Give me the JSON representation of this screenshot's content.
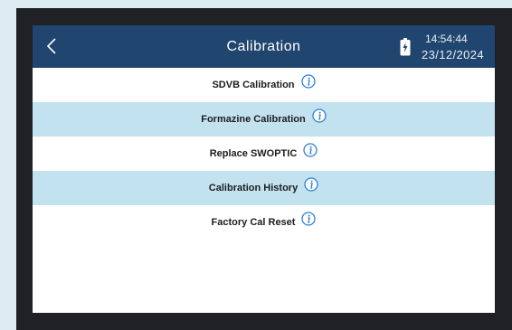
{
  "header": {
    "title": "Calibration",
    "time": "14:54:44",
    "date": "23/12/2024",
    "back_icon": "chevron-left-icon",
    "battery_icon": "battery-charging-icon"
  },
  "menu": {
    "items": [
      {
        "label": "SDVB Calibration",
        "info_icon": "info-icon"
      },
      {
        "label": "Formazine Calibration",
        "info_icon": "info-icon"
      },
      {
        "label": "Replace SWOPTIC",
        "info_icon": "info-icon"
      },
      {
        "label": "Calibration History",
        "info_icon": "info-icon"
      },
      {
        "label": "Factory Cal Reset",
        "info_icon": "info-icon"
      }
    ]
  },
  "colors": {
    "header_bg": "#20456e",
    "alt_row_bg": "#c3e2f0",
    "info_icon": "#2f7fd8",
    "page_bg": "#dceaf2",
    "bezel": "#202124"
  }
}
